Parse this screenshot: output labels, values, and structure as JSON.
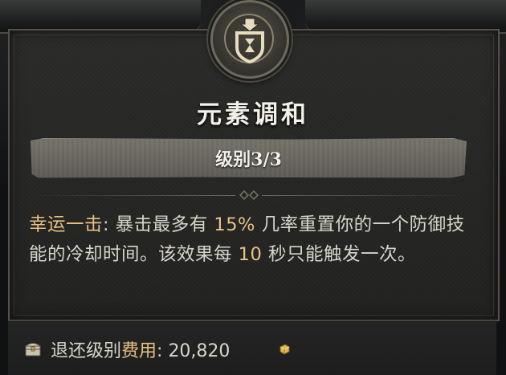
{
  "skill": {
    "name": "元素调和",
    "rank_text": "级别3/3"
  },
  "description": {
    "lucky_hit_label": "幸运一击",
    "colon": ": ",
    "part1": "暴击最多有 ",
    "chance_value": "15%",
    "part2": " 几率重置你的一个防御技能的冷却时间。该效果每 ",
    "cooldown_value": "10",
    "part3": " 秒只能触发一次。"
  },
  "footer": {
    "refund_prefix": "退还级别",
    "refund_cost_word": "费用",
    "refund_colon": ": ",
    "refund_amount": "20,820"
  },
  "icons": {
    "emblem": "defensive-skill-emblem-icon",
    "chest": "chest-icon",
    "gold": "gold-coin-icon"
  },
  "colors": {
    "highlight": "#e9c183",
    "text": "#d8d4cb",
    "title": "#f4f1ea"
  }
}
